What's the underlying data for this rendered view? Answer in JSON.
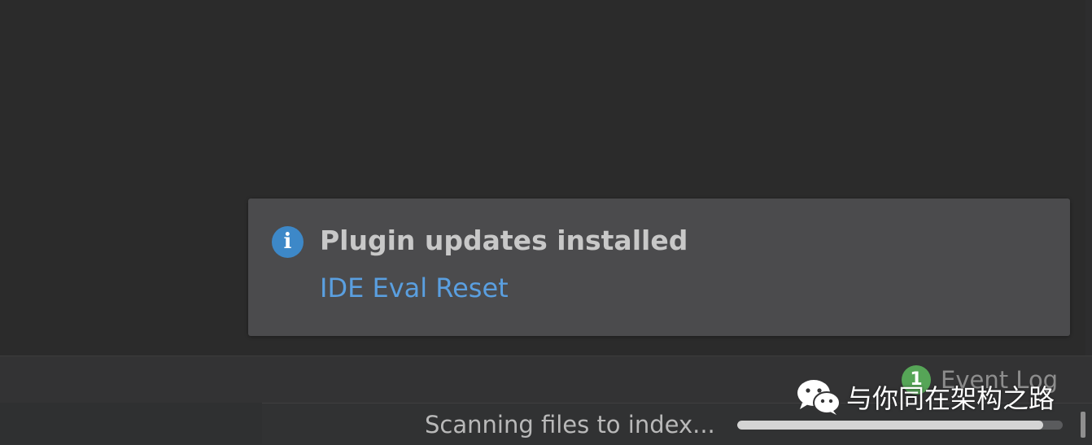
{
  "notification": {
    "icon": "info-icon",
    "icon_glyph": "i",
    "title": "Plugin updates installed",
    "link_label": "IDE Eval Reset"
  },
  "event_log": {
    "badge_count": "1",
    "label": "Event Log"
  },
  "watermark": {
    "icon": "wechat-icon",
    "text": "与你同在架构之路"
  },
  "status_bar": {
    "scan_text": "Scanning files to index...",
    "progress_fraction": 0.94
  },
  "colors": {
    "background": "#2b2b2b",
    "notification_bg": "#4b4b4d",
    "link": "#5a9fe0",
    "info_icon": "#3d88c8",
    "badge": "#56a557"
  }
}
